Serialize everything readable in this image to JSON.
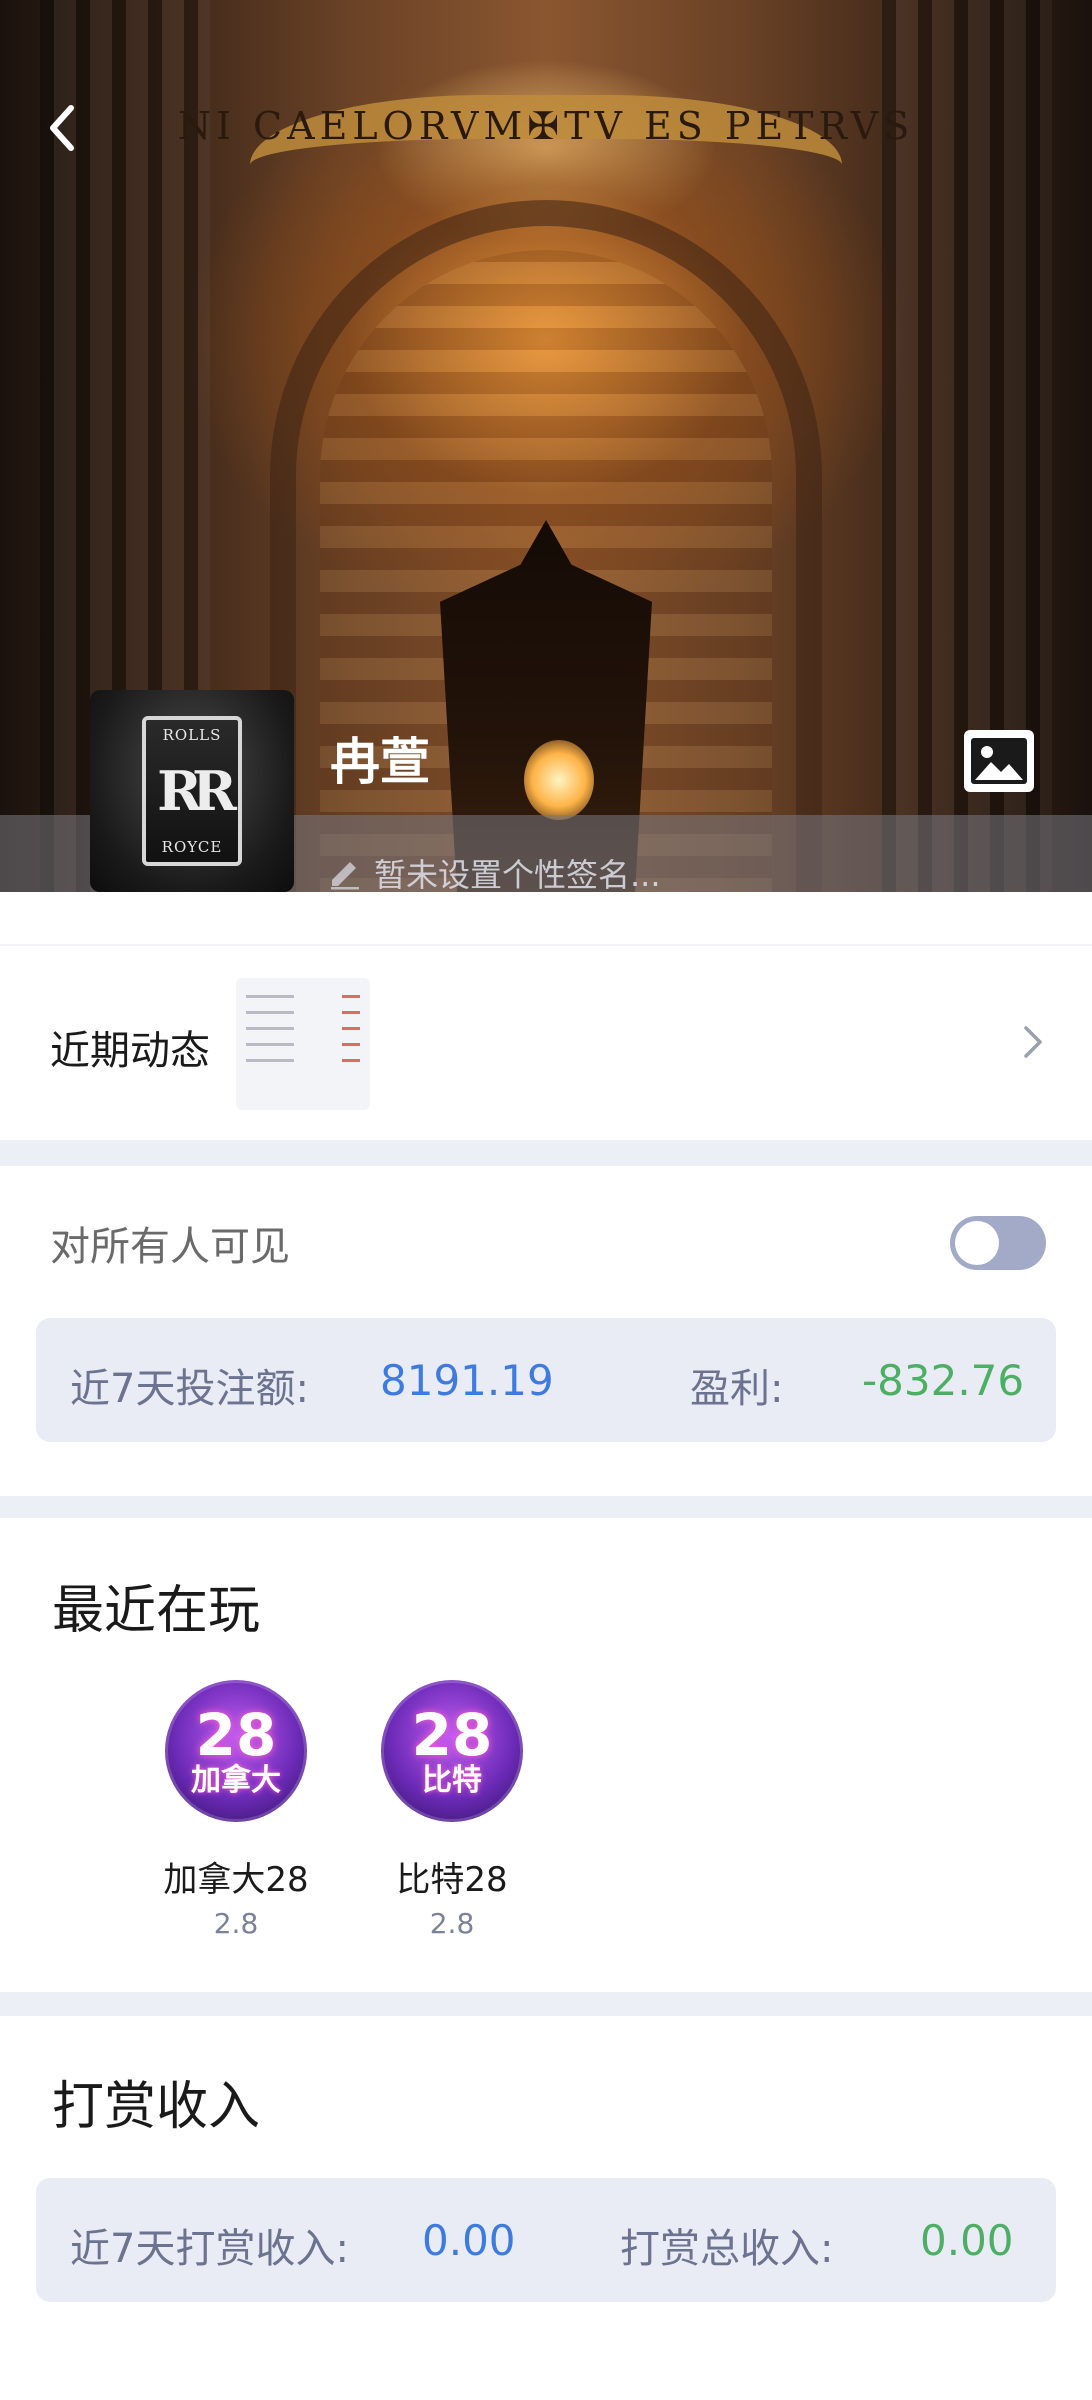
{
  "header": {
    "cover_inscription": "NI CAELORVM✠TV ES PETRVS",
    "avatar_badge_top": "ROLLS",
    "avatar_badge_mono": "RR",
    "avatar_badge_bottom": "ROYCE",
    "nickname": "冉萱",
    "signature_placeholder": "暂未设置个性签名..."
  },
  "recent_activity": {
    "label": "近期动态"
  },
  "visibility": {
    "label": "对所有人可见",
    "toggle_on": false
  },
  "betting_stats": {
    "bet_label": "近7天投注额:",
    "bet_value": "8191.19",
    "profit_label": "盈利:",
    "profit_value": "-832.76"
  },
  "recently_playing": {
    "title": "最近在玩",
    "games": [
      {
        "name": "加拿大28",
        "odds": "2.8",
        "icon_top": "28",
        "icon_bottom": "加拿大"
      },
      {
        "name": "比特28",
        "odds": "2.8",
        "icon_top": "28",
        "icon_bottom": "比特"
      }
    ]
  },
  "reward_income": {
    "title": "打赏收入",
    "week_label": "近7天打赏收入:",
    "week_value": "0.00",
    "total_label": "打赏总收入:",
    "total_value": "0.00"
  },
  "colors": {
    "accent_blue": "#3d7be0",
    "profit_green": "#4caf63",
    "section_gap": "#eceff6",
    "toggle_off": "#a3aac8"
  },
  "icons": [
    "back-icon",
    "image-icon",
    "pencil-icon",
    "chevron-right-icon"
  ]
}
